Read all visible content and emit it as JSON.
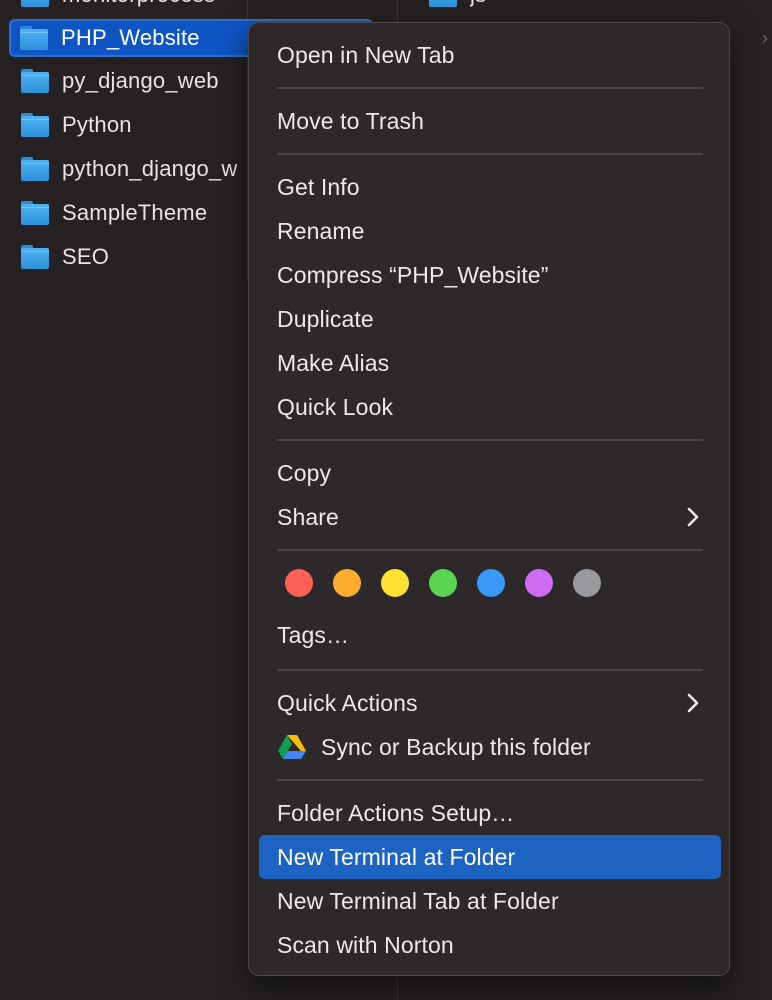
{
  "finder": {
    "partial_top_item": "monitorprocess",
    "partial_right_item": "js",
    "items": [
      {
        "name": "PHP_Website",
        "selected": true
      },
      {
        "name": "py_django_web"
      },
      {
        "name": "Python"
      },
      {
        "name": "python_django_w"
      },
      {
        "name": "SampleTheme"
      },
      {
        "name": "SEO"
      }
    ]
  },
  "context_menu": {
    "open_new_tab": "Open in New Tab",
    "move_to_trash": "Move to Trash",
    "get_info": "Get Info",
    "rename": "Rename",
    "compress": "Compress “PHP_Website”",
    "duplicate": "Duplicate",
    "make_alias": "Make Alias",
    "quick_look": "Quick Look",
    "copy": "Copy",
    "share": "Share",
    "tag_colors": [
      "#fe5f57",
      "#fead2e",
      "#fee133",
      "#5ad453",
      "#3a98f8",
      "#cc6cf0",
      "#98989d"
    ],
    "tags": "Tags…",
    "quick_actions": "Quick Actions",
    "sync_backup": "Sync or Backup this folder",
    "folder_actions_setup": "Folder Actions Setup…",
    "new_terminal": "New Terminal at Folder",
    "new_terminal_tab": "New Terminal Tab at Folder",
    "scan_norton": "Scan with Norton"
  },
  "colors": {
    "highlight": "#1c63c2",
    "selection": "#0f55c4",
    "menu_bg": "#2d292a",
    "window_bg": "#262223"
  }
}
